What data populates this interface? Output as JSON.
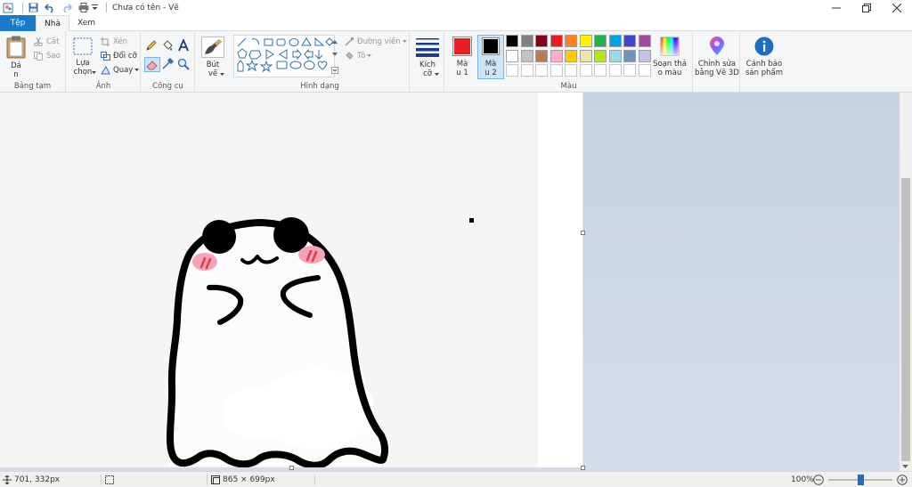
{
  "titlebar": {
    "title": "Chưa có tên - Vẽ",
    "minimize_icon": "minimize-icon",
    "restore_icon": "restore-icon",
    "close_icon": "close-icon"
  },
  "tabs": [
    {
      "label": "Tệp"
    },
    {
      "label": "Nhà"
    },
    {
      "label": "Xem"
    }
  ],
  "ribbon": {
    "clipboard": {
      "paste_label": "Dá\nn",
      "paste_l1": "Dá",
      "paste_l2": "n",
      "cut_label": "Cắt",
      "copy_label": "Sao",
      "group_label": "Bảng tạm"
    },
    "image": {
      "select_l1": "Lựa",
      "select_l2": "chọn",
      "crop_label": "Xén",
      "resize_label": "Đổi cỡ",
      "rotate_label": "Quay",
      "group_label": "Ảnh"
    },
    "tools": {
      "group_label": "Công cụ"
    },
    "brushes": {
      "l1": "Bút",
      "l2": "vẽ"
    },
    "shapes": {
      "outline_label": "Đường viền",
      "fill_label": "Tô",
      "group_label": "Hình dạng"
    },
    "size": {
      "l1": "Kích",
      "l2": "cỡ"
    },
    "colors": {
      "color1_l1": "Mà",
      "color1_l2": "u 1",
      "color2_l1": "Mà",
      "color2_l2": "u 2",
      "color1": "#e81e27",
      "color2": "#000000",
      "edit_colors_l1": "Soạn thả",
      "edit_colors_l2": "o màu",
      "group_label": "Màu",
      "palette_row1": [
        "#000000",
        "#7f7f7f",
        "#880015",
        "#ed1c24",
        "#ff7f27",
        "#fff200",
        "#22b14c",
        "#00a2e8",
        "#3f48cc",
        "#a349a4"
      ],
      "palette_row2": [
        "#ffffff",
        "#c3c3c3",
        "#b97a57",
        "#ffaec9",
        "#ffc90e",
        "#efe4b0",
        "#b5e61d",
        "#99d9ea",
        "#7092be",
        "#c8bfe7"
      ]
    },
    "paint3d": {
      "l1": "Chỉnh sửa",
      "l2": "bằng Vẽ 3D"
    },
    "product_alert": {
      "l1": "Cảnh báo",
      "l2": "sản phẩm"
    }
  },
  "statusbar": {
    "cursor_pos": "701, 332px",
    "canvas_size": "865 × 699px",
    "zoom": "100%",
    "zoom_level": 1.0
  }
}
